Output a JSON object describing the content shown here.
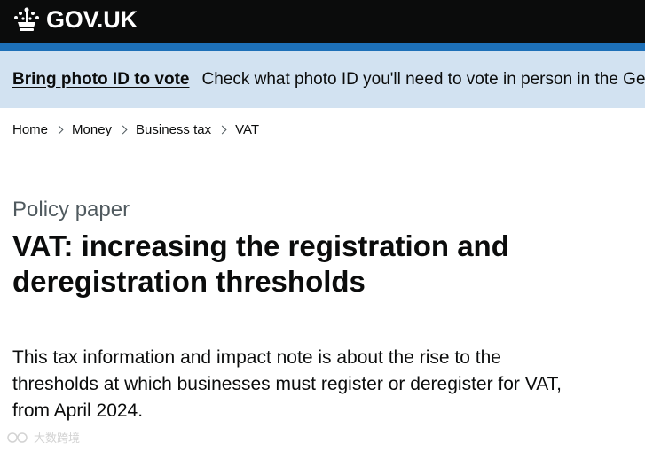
{
  "header": {
    "logo_text": "GOV.UK",
    "logo_icon": "crown-icon"
  },
  "banner": {
    "link_text": "Bring photo ID to vote",
    "text": "Check what photo ID you'll need to vote in person in the Genera"
  },
  "breadcrumbs": [
    "Home",
    "Money",
    "Business tax",
    "VAT"
  ],
  "page": {
    "caption": "Policy paper",
    "title": "VAT: increasing the registration and deregistration thresholds",
    "lead": "This tax information and impact note is about the rise to the thresholds at which businesses must register or deregister for VAT, from April 2024."
  },
  "watermark": {
    "text": "大数跨境",
    "icon": "watermark-logo-icon"
  },
  "colors": {
    "header_bg": "#0b0c0c",
    "blue_bar": "#1d70b8",
    "banner_bg": "#d2e2f1",
    "caption": "#505a5f"
  }
}
